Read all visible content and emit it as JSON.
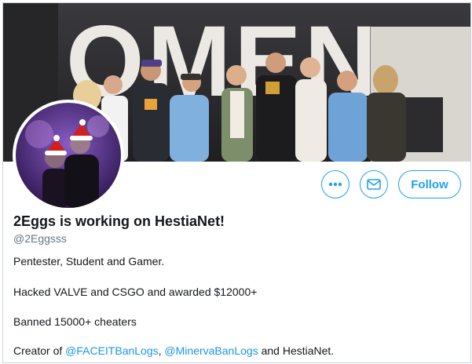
{
  "banner": {
    "backdrop_text": "OMEN"
  },
  "profile": {
    "display_name": "2Eggs is working on HestiaNet!",
    "handle": "@2Eggsss",
    "bio": {
      "line1": "Pentester, Student and Gamer.",
      "line2": "Hacked VALVE and CSGO and awarded $12000+",
      "line3": "Banned 15000+ cheaters",
      "line4_prefix": "Creator of ",
      "line4_link1": "@FACEITBanLogs",
      "line4_sep": ", ",
      "line4_link2": "@MinervaBanLogs",
      "line4_suffix": " and HestiaNet."
    }
  },
  "actions": {
    "more_icon": "more-dots-icon",
    "message_icon": "envelope-icon",
    "follow_label": "Follow"
  },
  "colors": {
    "accent": "#1da1f2",
    "link": "#1b95e0",
    "text": "#14171a",
    "muted": "#657786"
  }
}
